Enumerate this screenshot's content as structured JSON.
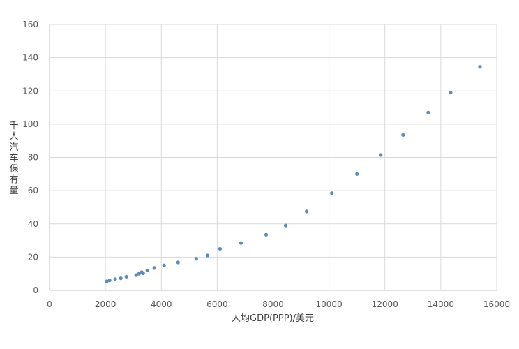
{
  "chart_data": {
    "type": "scatter",
    "xlabel": "人均GDP(PPP)/美元",
    "ylabel": "千人汽车保有量",
    "xlim": [
      0,
      16000
    ],
    "ylim": [
      0,
      160
    ],
    "x_ticks": [
      0,
      2000,
      4000,
      6000,
      8000,
      10000,
      12000,
      14000,
      16000
    ],
    "y_ticks": [
      0,
      20,
      40,
      60,
      80,
      100,
      120,
      140,
      160
    ],
    "grid": true,
    "legend": "none",
    "marker_color": "#5b8db8",
    "points": [
      {
        "x": 2050,
        "y": 5.5
      },
      {
        "x": 2150,
        "y": 6
      },
      {
        "x": 2350,
        "y": 6.8
      },
      {
        "x": 2550,
        "y": 7.3
      },
      {
        "x": 2750,
        "y": 8.2
      },
      {
        "x": 3100,
        "y": 9.2
      },
      {
        "x": 3200,
        "y": 10
      },
      {
        "x": 3300,
        "y": 11
      },
      {
        "x": 3350,
        "y": 10.3
      },
      {
        "x": 3500,
        "y": 12
      },
      {
        "x": 3750,
        "y": 13.5
      },
      {
        "x": 4100,
        "y": 15
      },
      {
        "x": 4600,
        "y": 16.8
      },
      {
        "x": 5250,
        "y": 19
      },
      {
        "x": 5650,
        "y": 21
      },
      {
        "x": 6100,
        "y": 25
      },
      {
        "x": 6850,
        "y": 28.5
      },
      {
        "x": 7750,
        "y": 33.5
      },
      {
        "x": 8450,
        "y": 39
      },
      {
        "x": 9200,
        "y": 47.5
      },
      {
        "x": 10100,
        "y": 58.5
      },
      {
        "x": 11000,
        "y": 70
      },
      {
        "x": 11850,
        "y": 81.5
      },
      {
        "x": 12650,
        "y": 93.5
      },
      {
        "x": 13550,
        "y": 107
      },
      {
        "x": 14350,
        "y": 119
      },
      {
        "x": 15400,
        "y": 134.5
      }
    ]
  }
}
